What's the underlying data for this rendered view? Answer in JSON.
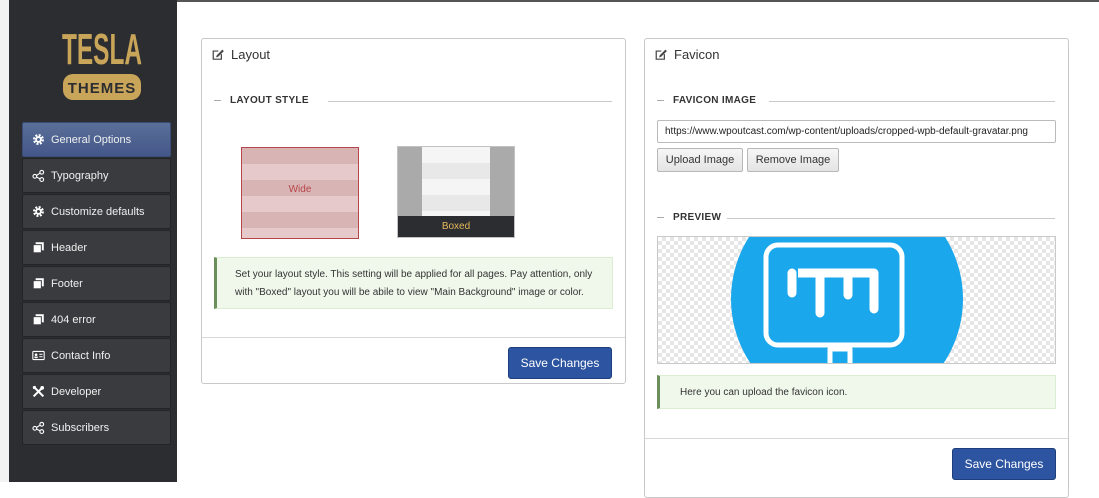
{
  "brand": {
    "logo_top": "TESLA",
    "logo_bottom": "THEMES",
    "gold": "#c9a55a"
  },
  "sidebar": {
    "items": [
      {
        "label": "General Options",
        "icon": "gear-icon",
        "active": true
      },
      {
        "label": "Typography",
        "icon": "share-icon"
      },
      {
        "label": "Customize defaults",
        "icon": "gear-icon"
      },
      {
        "label": "Header",
        "icon": "copy-icon"
      },
      {
        "label": "Footer",
        "icon": "copy-icon"
      },
      {
        "label": "404 error",
        "icon": "copy-icon"
      },
      {
        "label": "Contact Info",
        "icon": "contact-card-icon"
      },
      {
        "label": "Developer",
        "icon": "tools-icon"
      },
      {
        "label": "Subscribers",
        "icon": "share-icon"
      }
    ]
  },
  "layout_panel": {
    "title": "Layout",
    "section_title": "LAYOUT STYLE",
    "options": [
      {
        "label": "Wide",
        "selected": true
      },
      {
        "label": "Boxed",
        "selected": false
      }
    ],
    "note": "Set your layout style. This setting will be applied for all pages. Pay attention, only with \"Boxed\" layout you will be abile to view \"Main Background\" image or color.",
    "save_label": "Save Changes"
  },
  "favicon_panel": {
    "title": "Favicon",
    "section_title": "FAVICON IMAGE",
    "url_value": "https://www.wpoutcast.com/wp-content/uploads/cropped-wpb-default-gravatar.png",
    "upload_label": "Upload Image",
    "remove_label": "Remove Image",
    "preview_title": "PREVIEW",
    "note": "Here you can upload the favicon icon.",
    "save_label": "Save Changes"
  },
  "colors": {
    "accent": "#2c54a0",
    "sidebar_bg": "#2c2d30",
    "active_nav": "#4d6190",
    "preview_blue": "#1aa7ec"
  }
}
